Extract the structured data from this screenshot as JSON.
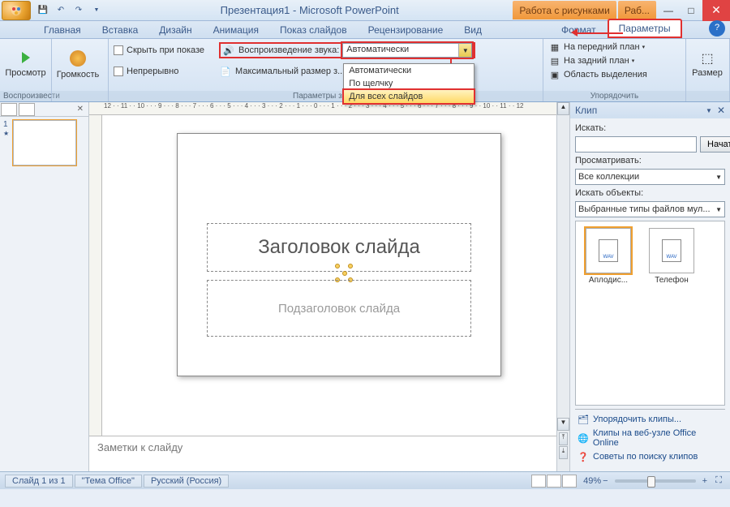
{
  "title": "Презентация1 - Microsoft PowerPoint",
  "ctx_tabs": {
    "a": "Работа с рисунками",
    "b": "Раб..."
  },
  "tabs": {
    "home": "Главная",
    "insert": "Вставка",
    "design": "Дизайн",
    "anim": "Анимация",
    "show": "Показ слайдов",
    "review": "Рецензирование",
    "view": "Вид",
    "format": "Формат",
    "params": "Параметры"
  },
  "ribbon": {
    "preview_label": "Просмотр",
    "preview_group": "Воспроизвести",
    "volume_label": "Громкость",
    "hide_show": "Скрыть при показе",
    "loop": "Непрерывно",
    "play_sound": "Воспроизведение звука:",
    "max_size": "Максимальный размер з...",
    "sound_group": "Параметры звука",
    "combo_value": "Автоматически",
    "dd": {
      "auto": "Автоматически",
      "click": "По щелчку",
      "all": "Для всех слайдов"
    },
    "arrange": {
      "front": "На передний план",
      "back": "На задний план",
      "select": "Область выделения",
      "group": "Упорядочить"
    },
    "size": "Размер"
  },
  "slide": {
    "title": "Заголовок слайда",
    "subtitle": "Подзаголовок слайда",
    "notes": "Заметки к слайду"
  },
  "clip": {
    "title": "Клип",
    "search_label": "Искать:",
    "go": "Начать",
    "browse_label": "Просматривать:",
    "browse_value": "Все коллекции",
    "objects_label": "Искать объекты:",
    "objects_value": "Выбранные типы файлов мул...",
    "item1": "Аплодис...",
    "item2": "Телефон",
    "link1": "Упорядочить клипы...",
    "link2": "Клипы на веб-узле Office Online",
    "link3": "Советы по поиску клипов"
  },
  "status": {
    "slide": "Слайд 1 из 1",
    "theme": "\"Тема Office\"",
    "lang": "Русский (Россия)",
    "zoom": "49%"
  },
  "ruler_h": "12 · · 11 · · 10 · · · 9 · · · 8 · · · 7 · · · 6 · · · 5 · · · 4 · · · 3 · · · 2 · · · 1 · · · 0 · · · 1 · · · 2 · · · 3 · · · 4 · · · 5 · · · 6 · · · 7 · · · 8 · · · 9 · · 10 · · 11 · · 12"
}
